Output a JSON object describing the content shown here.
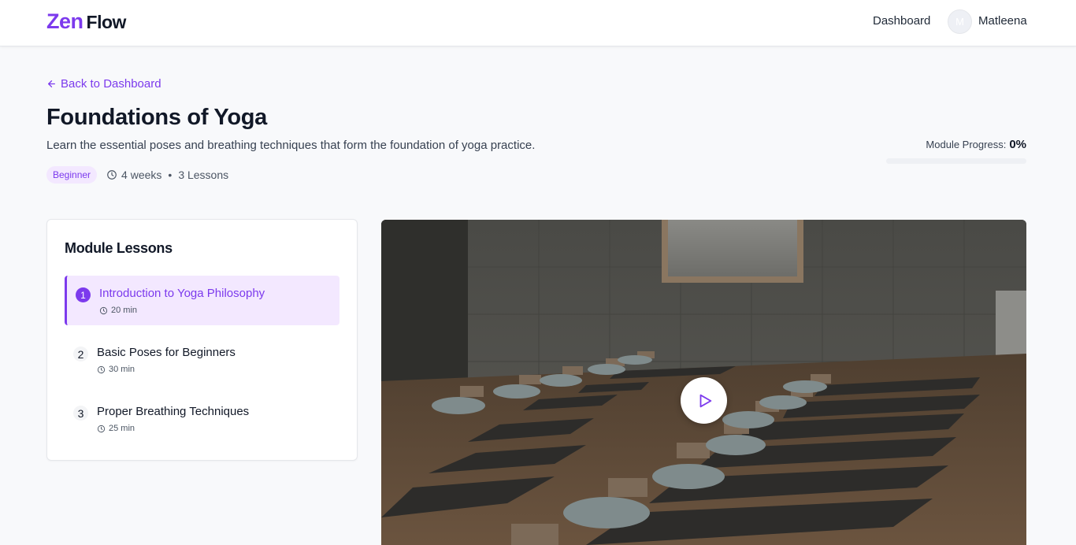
{
  "header": {
    "logo_primary": "Zen",
    "logo_secondary": "Flow",
    "nav_dashboard": "Dashboard",
    "avatar_initial": "M",
    "username": "Matleena"
  },
  "back_link": "Back to Dashboard",
  "module": {
    "title": "Foundations of Yoga",
    "description": "Learn the essential poses and breathing techniques that form the foundation of yoga practice.",
    "level": "Beginner",
    "duration": "4 weeks",
    "separator": "•",
    "lessons_count": "3 Lessons",
    "progress_label": "Module Progress:",
    "progress_value": "0%",
    "progress_fraction": 0
  },
  "lessons_panel": {
    "title": "Module Lessons",
    "items": [
      {
        "number": "1",
        "name": "Introduction to Yoga Philosophy",
        "duration": "20 min",
        "active": true
      },
      {
        "number": "2",
        "name": "Basic Poses for Beginners",
        "duration": "30 min",
        "active": false
      },
      {
        "number": "3",
        "name": "Proper Breathing Techniques",
        "duration": "25 min",
        "active": false
      }
    ]
  },
  "video": {
    "play_icon": "play-icon"
  },
  "colors": {
    "accent": "#7c3aed",
    "accent_light": "#f3e8ff",
    "text": "#111827",
    "background": "#f8f9fb"
  }
}
